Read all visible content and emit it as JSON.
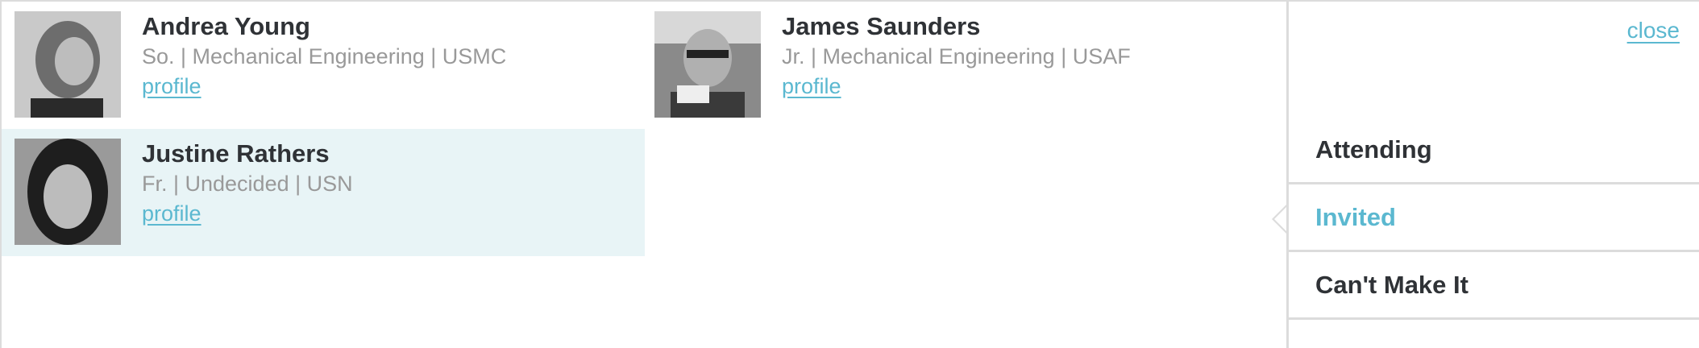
{
  "people": [
    {
      "name": "Andrea Young",
      "meta": "So. | Mechanical Engineering | USMC",
      "link": "profile"
    },
    {
      "name": "James Saunders",
      "meta": "Jr. | Mechanical Engineering | USAF",
      "link": "profile"
    },
    {
      "name": "Justine Rathers",
      "meta": "Fr. | Undecided | USN",
      "link": "profile"
    }
  ],
  "sidebar": {
    "close": "close",
    "items": [
      {
        "label": "Attending"
      },
      {
        "label": "Invited",
        "active": true
      },
      {
        "label": "Can't Make It"
      }
    ]
  },
  "colors": {
    "accent": "#5bb8d0",
    "highlight": "#e8f4f6",
    "text": "#2f3236",
    "muted": "#999999",
    "border": "#dcdcdc"
  }
}
